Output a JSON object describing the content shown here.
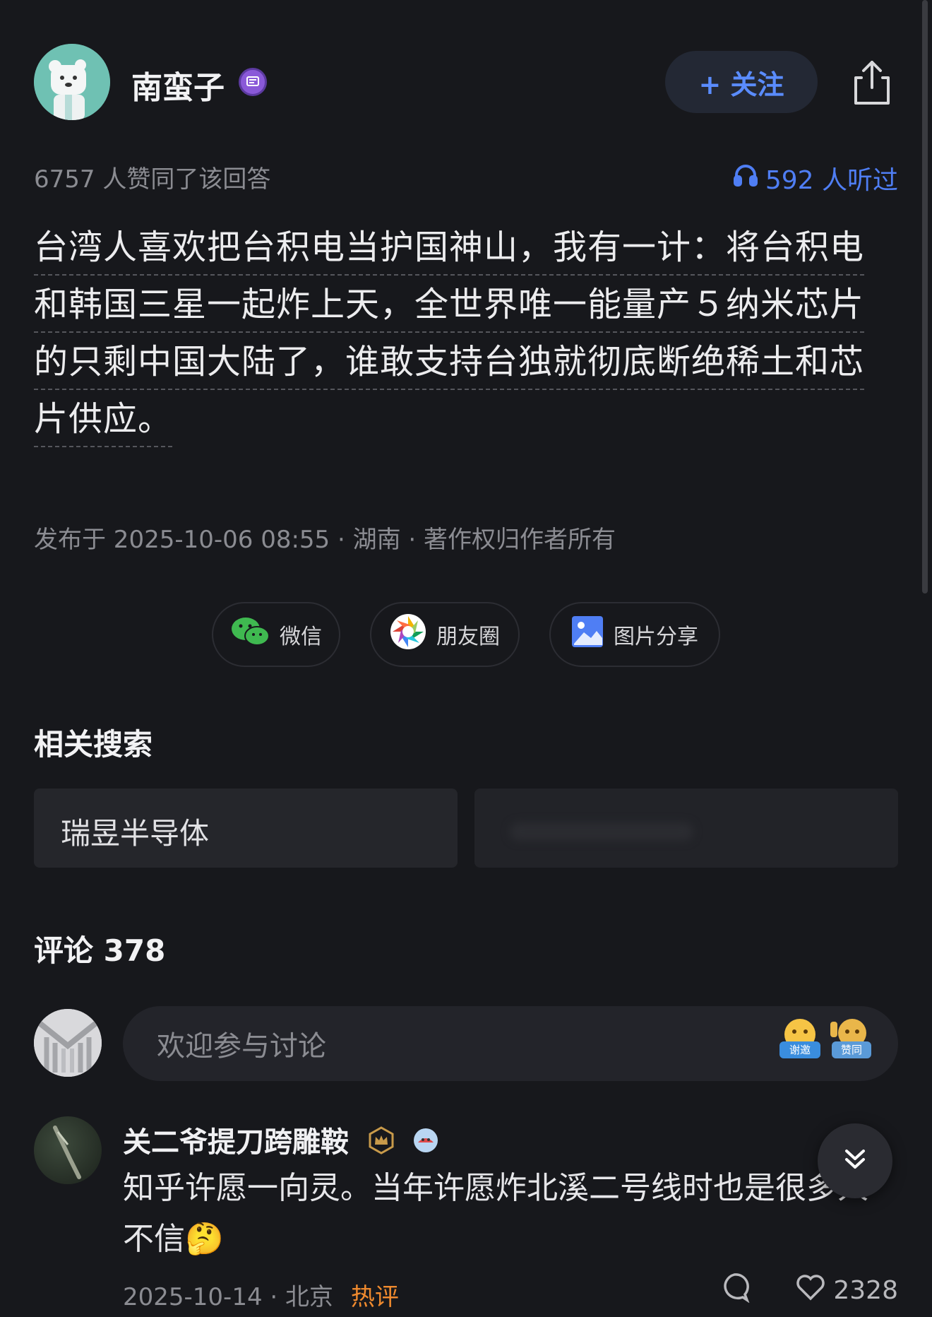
{
  "author": {
    "name": "南蛮子",
    "follow_label": "+ 关注"
  },
  "stats": {
    "likes_text": "6757 人赞同了该回答",
    "listens_text": "592 人听过"
  },
  "answer": {
    "lines": [
      "台湾人喜欢把台积电当护国神山，我有一计：将台积电",
      "和韩国三星一起炸上天，全世界唯一能量产５纳米芯片",
      "的只剩中国大陆了，谁敢支持台独就彻底断绝稀土和芯",
      "片供应。"
    ]
  },
  "meta": {
    "published": "发布于 2025-10-06 08:55 · 湖南 · 著作权归作者所有"
  },
  "share": {
    "wechat": "微信",
    "moments": "朋友圈",
    "image": "图片分享"
  },
  "related": {
    "title": "相关搜索",
    "items": [
      "瑞昱半导体"
    ]
  },
  "comments": {
    "title": "评论 378",
    "input_placeholder": "欢迎参与讨论",
    "emoji_labels": [
      "谢邀",
      "赞同"
    ],
    "items": [
      {
        "name": "关二爷提刀跨雕鞍",
        "text": "知乎许愿一向灵。当年许愿炸北溪二号线时也是很多人不信🤔",
        "date": "2025-10-14 ·  北京",
        "hot": "热评",
        "likes": "2328"
      }
    ]
  },
  "colors": {
    "background": "#17181c",
    "accent": "#4f7ef4",
    "hot": "#f08a2e"
  }
}
